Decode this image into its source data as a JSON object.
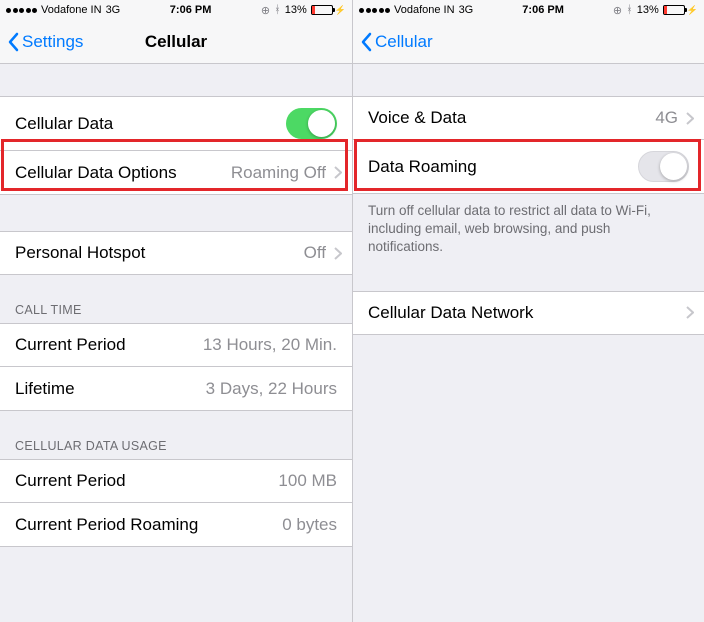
{
  "status_bar": {
    "carrier": "Vodafone IN",
    "network": "3G",
    "time": "7:06 PM",
    "battery_pct": "13%"
  },
  "left_pane": {
    "nav": {
      "back_label": "Settings",
      "title": "Cellular"
    },
    "rows": {
      "cellular_data": {
        "label": "Cellular Data",
        "toggle": "on"
      },
      "cellular_data_options": {
        "label": "Cellular Data Options",
        "value": "Roaming Off"
      },
      "personal_hotspot": {
        "label": "Personal Hotspot",
        "value": "Off"
      }
    },
    "sections": {
      "call_time": {
        "header": "CALL TIME",
        "rows": [
          {
            "label": "Current Period",
            "value": "13 Hours, 20 Min."
          },
          {
            "label": "Lifetime",
            "value": "3 Days, 22 Hours"
          }
        ]
      },
      "data_usage": {
        "header": "CELLULAR DATA USAGE",
        "rows": [
          {
            "label": "Current Period",
            "value": "100 MB"
          },
          {
            "label": "Current Period Roaming",
            "value": "0 bytes"
          }
        ]
      }
    }
  },
  "right_pane": {
    "nav": {
      "back_label": "Cellular",
      "title": ""
    },
    "rows": {
      "voice_data": {
        "label": "Voice & Data",
        "value": "4G"
      },
      "data_roaming": {
        "label": "Data Roaming",
        "toggle": "off"
      },
      "cellular_network": {
        "label": "Cellular Data Network"
      }
    },
    "footer": "Turn off cellular data to restrict all data to Wi-Fi, including email, web browsing, and push notifications."
  }
}
